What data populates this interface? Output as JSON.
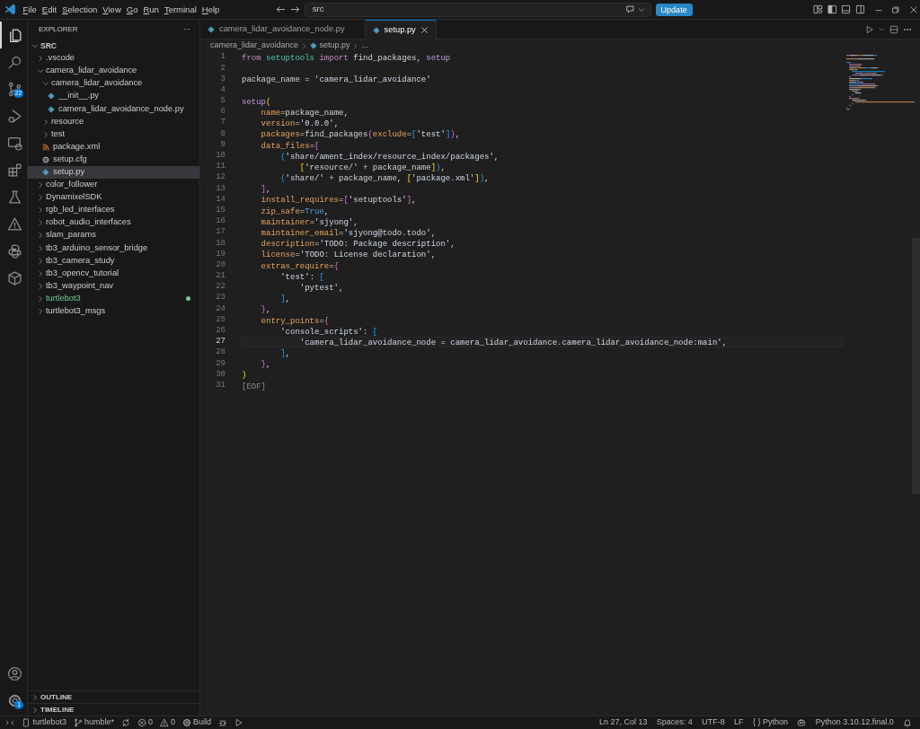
{
  "title_bar": {
    "menus": [
      "File",
      "Edit",
      "Selection",
      "View",
      "Go",
      "Run",
      "Terminal",
      "Help"
    ],
    "search": {
      "value": "src"
    },
    "update_button": "Update"
  },
  "activity_bar": {
    "items": [
      {
        "kind": "explorer",
        "selected": true
      },
      {
        "kind": "search",
        "selected": false
      },
      {
        "kind": "scm",
        "selected": false,
        "badge": "22"
      },
      {
        "kind": "debug",
        "selected": false
      },
      {
        "kind": "remote",
        "selected": false
      },
      {
        "kind": "extensions",
        "selected": false
      },
      {
        "kind": "testing",
        "selected": false
      },
      {
        "kind": "triangle",
        "selected": false
      },
      {
        "kind": "python",
        "selected": false
      },
      {
        "kind": "box",
        "selected": false
      }
    ],
    "bottom": [
      {
        "kind": "account",
        "selected": false
      },
      {
        "kind": "settings",
        "selected": false,
        "badge": "1"
      }
    ]
  },
  "explorer": {
    "title": "EXPLORER",
    "more": "···",
    "root": {
      "name": "SRC",
      "expanded": true,
      "children": [
        {
          "name": ".vscode",
          "kind": "folder",
          "expanded": false,
          "selected": false
        },
        {
          "name": "camera_lidar_avoidance",
          "kind": "folder",
          "expanded": true,
          "selected": false,
          "children": [
            {
              "name": "camera_lidar_avoidance",
              "kind": "folder",
              "expanded": true,
              "selected": false,
              "children": [
                {
                  "name": "__init__.py",
                  "kind": "python",
                  "selected": false
                },
                {
                  "name": "camera_lidar_avoidance_node.py",
                  "kind": "python",
                  "selected": false
                }
              ]
            },
            {
              "name": "resource",
              "kind": "folder",
              "expanded": false,
              "selected": false
            },
            {
              "name": "test",
              "kind": "folder",
              "expanded": false,
              "selected": false
            },
            {
              "name": "package.xml",
              "kind": "xml",
              "selected": false
            },
            {
              "name": "setup.cfg",
              "kind": "config",
              "selected": false
            },
            {
              "name": "setup.py",
              "kind": "python",
              "selected": true
            }
          ]
        },
        {
          "name": "color_follower",
          "kind": "folder",
          "expanded": false,
          "selected": false
        },
        {
          "name": "DynamixelSDK",
          "kind": "folder",
          "expanded": false,
          "selected": false
        },
        {
          "name": "rgb_led_interfaces",
          "kind": "folder",
          "expanded": false,
          "selected": false
        },
        {
          "name": "robot_audio_interfaces",
          "kind": "folder",
          "expanded": false,
          "selected": false
        },
        {
          "name": "slam_params",
          "kind": "folder",
          "expanded": false,
          "selected": false
        },
        {
          "name": "tb3_arduino_sensor_bridge",
          "kind": "folder",
          "expanded": false,
          "selected": false
        },
        {
          "name": "tb3_camera_study",
          "kind": "folder",
          "expanded": false,
          "selected": false
        },
        {
          "name": "tb3_opencv_tutorial",
          "kind": "folder",
          "expanded": false,
          "selected": false
        },
        {
          "name": "tb3_waypoint_nav",
          "kind": "folder",
          "expanded": false,
          "selected": false
        },
        {
          "name": "turtlebot3",
          "kind": "folder",
          "expanded": false,
          "selected": false,
          "color": "#73c991"
        },
        {
          "name": "turtlebot3_msgs",
          "kind": "folder",
          "expanded": false,
          "selected": false
        }
      ]
    },
    "sections": [
      {
        "name": "OUTLINE",
        "expanded": false
      },
      {
        "name": "TIMELINE",
        "expanded": false
      }
    ]
  },
  "tabs": [
    {
      "label": "camera_lidar_avoidance_node.py",
      "selected": false
    },
    {
      "label": "setup.py",
      "selected": true
    }
  ],
  "breadcrumb": [
    {
      "text": "camera_lidar_avoidance",
      "kind": "folder"
    },
    {
      "text": "setup.py",
      "kind": "python"
    },
    {
      "text": "...",
      "kind": "more"
    }
  ],
  "code": [
    {
      "number": "1",
      "current": false,
      "tokens": [
        {
          "kind": "kw",
          "text": "from "
        },
        {
          "kind": "mod",
          "text": "setuptools "
        },
        {
          "kind": "kw",
          "text": "import "
        },
        {
          "kind": "plain",
          "text": "find_packages, "
        },
        {
          "kind": "fn",
          "text": "setup"
        }
      ]
    },
    {
      "number": "2",
      "current": false
    },
    {
      "number": "3",
      "current": false,
      "tokens": [
        {
          "kind": "plain",
          "text": "package_name = "
        },
        {
          "kind": "str",
          "text": "'camera_lidar_avoidance'"
        }
      ]
    },
    {
      "number": "4",
      "current": false
    },
    {
      "number": "5",
      "current": false,
      "tokens": [
        {
          "kind": "fn",
          "text": "setup"
        },
        {
          "kind": "b1",
          "text": "("
        }
      ]
    },
    {
      "number": "6",
      "current": false,
      "tokens": [
        {
          "kind": "param",
          "text": "    name"
        },
        {
          "kind": "plain",
          "text": "=package_name,"
        }
      ]
    },
    {
      "number": "7",
      "current": false,
      "tokens": [
        {
          "kind": "param",
          "text": "    version"
        },
        {
          "kind": "plain",
          "text": "="
        },
        {
          "kind": "str",
          "text": "'0.0.0'"
        },
        {
          "kind": "plain",
          "text": ","
        }
      ]
    },
    {
      "number": "8",
      "current": false,
      "tokens": [
        {
          "kind": "param",
          "text": "    packages"
        },
        {
          "kind": "plain",
          "text": "=find_packages"
        },
        {
          "kind": "b2",
          "text": "("
        },
        {
          "kind": "param",
          "text": "exclude"
        },
        {
          "kind": "plain",
          "text": "="
        },
        {
          "kind": "b3",
          "text": "["
        },
        {
          "kind": "str",
          "text": "'test'"
        },
        {
          "kind": "b3",
          "text": "]"
        },
        {
          "kind": "b2",
          "text": ")"
        },
        {
          "kind": "plain",
          "text": ","
        }
      ]
    },
    {
      "number": "9",
      "current": false,
      "tokens": [
        {
          "kind": "param",
          "text": "    data_files"
        },
        {
          "kind": "plain",
          "text": "="
        },
        {
          "kind": "b2",
          "text": "["
        }
      ]
    },
    {
      "number": "10",
      "current": false,
      "tokens": [
        {
          "kind": "b3",
          "text": "        ("
        },
        {
          "kind": "str",
          "text": "'share/ament_index/resource_index/packages'"
        },
        {
          "kind": "plain",
          "text": ","
        }
      ]
    },
    {
      "number": "11",
      "current": false,
      "tokens": [
        {
          "kind": "b1",
          "text": "            ["
        },
        {
          "kind": "str",
          "text": "'resource/'"
        },
        {
          "kind": "plain",
          "text": " + package_name"
        },
        {
          "kind": "b1",
          "text": "]"
        },
        {
          "kind": "b3",
          "text": ")"
        },
        {
          "kind": "plain",
          "text": ","
        }
      ]
    },
    {
      "number": "12",
      "current": false,
      "tokens": [
        {
          "kind": "b3",
          "text": "        ("
        },
        {
          "kind": "str",
          "text": "'share/'"
        },
        {
          "kind": "plain",
          "text": " + package_name, "
        },
        {
          "kind": "b1",
          "text": "["
        },
        {
          "kind": "str",
          "text": "'package.xml'"
        },
        {
          "kind": "b1",
          "text": "]"
        },
        {
          "kind": "b3",
          "text": ")"
        },
        {
          "kind": "plain",
          "text": ","
        }
      ]
    },
    {
      "number": "13",
      "current": false,
      "tokens": [
        {
          "kind": "b2",
          "text": "    ]"
        },
        {
          "kind": "plain",
          "text": ","
        }
      ]
    },
    {
      "number": "14",
      "current": false,
      "tokens": [
        {
          "kind": "param",
          "text": "    install_requires"
        },
        {
          "kind": "plain",
          "text": "="
        },
        {
          "kind": "b2",
          "text": "["
        },
        {
          "kind": "str",
          "text": "'setuptools'"
        },
        {
          "kind": "b2",
          "text": "]"
        },
        {
          "kind": "plain",
          "text": ","
        }
      ]
    },
    {
      "number": "15",
      "current": false,
      "tokens": [
        {
          "kind": "param",
          "text": "    zip_safe"
        },
        {
          "kind": "plain",
          "text": "="
        },
        {
          "kind": "const",
          "text": "True"
        },
        {
          "kind": "plain",
          "text": ","
        }
      ]
    },
    {
      "number": "16",
      "current": false,
      "tokens": [
        {
          "kind": "param",
          "text": "    maintainer"
        },
        {
          "kind": "plain",
          "text": "="
        },
        {
          "kind": "str",
          "text": "'sjyong'"
        },
        {
          "kind": "plain",
          "text": ","
        }
      ]
    },
    {
      "number": "17",
      "current": false,
      "tokens": [
        {
          "kind": "param",
          "text": "    maintainer_email"
        },
        {
          "kind": "plain",
          "text": "="
        },
        {
          "kind": "str",
          "text": "'sjyong@todo.todo'"
        },
        {
          "kind": "plain",
          "text": ","
        }
      ]
    },
    {
      "number": "18",
      "current": false,
      "tokens": [
        {
          "kind": "param",
          "text": "    description"
        },
        {
          "kind": "plain",
          "text": "="
        },
        {
          "kind": "str",
          "text": "'TODO: Package description'"
        },
        {
          "kind": "plain",
          "text": ","
        }
      ]
    },
    {
      "number": "19",
      "current": false,
      "tokens": [
        {
          "kind": "param",
          "text": "    license"
        },
        {
          "kind": "plain",
          "text": "="
        },
        {
          "kind": "str",
          "text": "'TODO: License declaration'"
        },
        {
          "kind": "plain",
          "text": ","
        }
      ]
    },
    {
      "number": "20",
      "current": false,
      "tokens": [
        {
          "kind": "param",
          "text": "    extras_require"
        },
        {
          "kind": "plain",
          "text": "="
        },
        {
          "kind": "b2",
          "text": "{"
        }
      ]
    },
    {
      "number": "21",
      "current": false,
      "tokens": [
        {
          "kind": "str",
          "text": "        'test'"
        },
        {
          "kind": "plain",
          "text": ": "
        },
        {
          "kind": "b3",
          "text": "["
        }
      ]
    },
    {
      "number": "22",
      "current": false,
      "tokens": [
        {
          "kind": "str",
          "text": "            'pytest'"
        },
        {
          "kind": "plain",
          "text": ","
        }
      ]
    },
    {
      "number": "23",
      "current": false,
      "tokens": [
        {
          "kind": "b3",
          "text": "        ]"
        },
        {
          "kind": "plain",
          "text": ","
        }
      ]
    },
    {
      "number": "24",
      "current": false,
      "tokens": [
        {
          "kind": "b2",
          "text": "    }"
        },
        {
          "kind": "plain",
          "text": ","
        }
      ]
    },
    {
      "number": "25",
      "current": false,
      "tokens": [
        {
          "kind": "param",
          "text": "    entry_points"
        },
        {
          "kind": "plain",
          "text": "="
        },
        {
          "kind": "b2",
          "text": "{"
        }
      ]
    },
    {
      "number": "26",
      "current": false,
      "tokens": [
        {
          "kind": "str",
          "text": "        'console_scripts'"
        },
        {
          "kind": "plain",
          "text": ": "
        },
        {
          "kind": "b3",
          "text": "["
        }
      ]
    },
    {
      "number": "27",
      "current": true,
      "tokens": [
        {
          "kind": "str",
          "text": "            'camera_lidar_avoidance_node = camera_lidar_avoidance.camera_lidar_avoidance_node:main'"
        },
        {
          "kind": "plain",
          "text": ","
        }
      ]
    },
    {
      "number": "28",
      "current": false,
      "tokens": [
        {
          "kind": "b3",
          "text": "        ]"
        },
        {
          "kind": "plain",
          "text": ","
        }
      ]
    },
    {
      "number": "29",
      "current": false,
      "tokens": [
        {
          "kind": "b2",
          "text": "    }"
        },
        {
          "kind": "plain",
          "text": ","
        }
      ]
    },
    {
      "number": "30",
      "current": false,
      "tokens": [
        {
          "kind": "b1",
          "text": ")"
        }
      ]
    },
    {
      "number": "31",
      "current": false,
      "tokens": [
        {
          "kind": "eof",
          "text": "[EOF]"
        }
      ]
    }
  ],
  "status_bar": {
    "left": [
      {
        "kind": "remote"
      },
      {
        "kind": "device",
        "text": "turtlebot3"
      },
      {
        "kind": "branch",
        "text": "humble*"
      },
      {
        "kind": "sync"
      },
      {
        "kind": "error",
        "text": "0"
      },
      {
        "kind": "warning",
        "text": "0"
      },
      {
        "kind": "gear",
        "text": "Build"
      },
      {
        "kind": "bug"
      },
      {
        "kind": "play"
      }
    ],
    "right": [
      {
        "kind": "text",
        "text": "Ln 27, Col 13"
      },
      {
        "kind": "text",
        "text": "Spaces: 4"
      },
      {
        "kind": "text",
        "text": "UTF-8"
      },
      {
        "kind": "text",
        "text": "LF"
      },
      {
        "kind": "text",
        "text": "{ } Python"
      },
      {
        "kind": "copilot"
      },
      {
        "kind": "text",
        "text": "Python 3.10.12.final.0"
      },
      {
        "kind": "bell"
      }
    ]
  }
}
